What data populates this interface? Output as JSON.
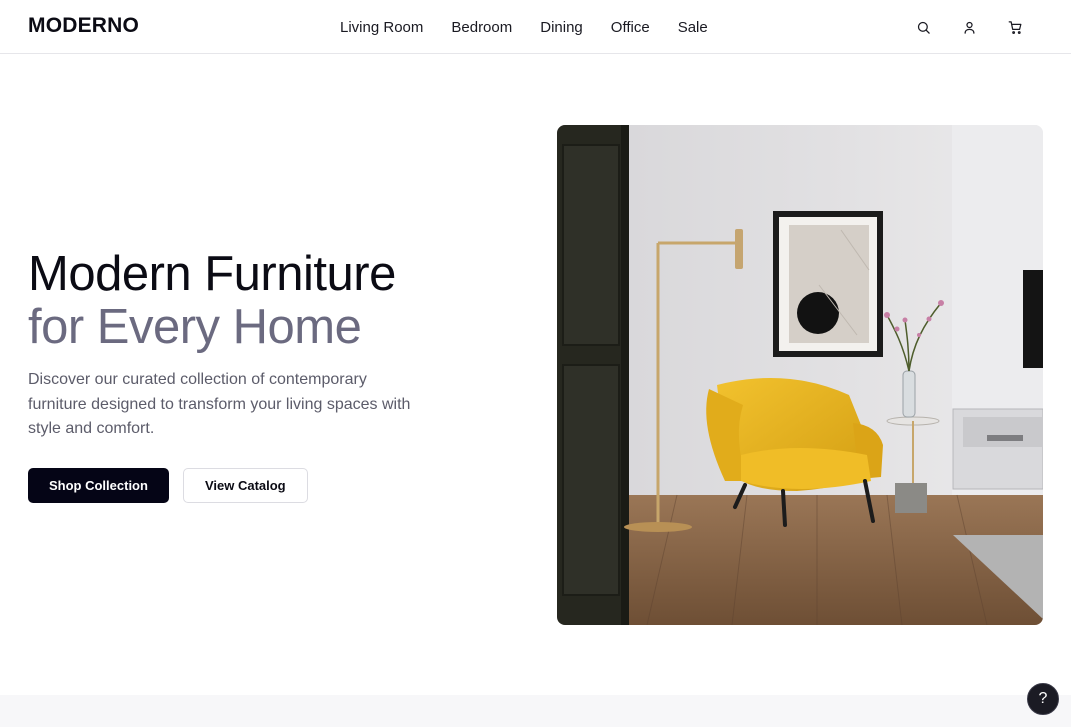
{
  "brand": {
    "name": "MODERNO"
  },
  "nav": {
    "items": [
      {
        "label": "Living Room"
      },
      {
        "label": "Bedroom"
      },
      {
        "label": "Dining"
      },
      {
        "label": "Office"
      },
      {
        "label": "Sale"
      }
    ]
  },
  "header_icons": [
    "search-icon",
    "user-icon",
    "cart-icon"
  ],
  "hero": {
    "title_line1": "Modern Furniture",
    "title_line2": "for Every Home",
    "description": "Discover our curated collection of contemporary furniture designed to transform your living spaces with style and comfort.",
    "primary_button": "Shop Collection",
    "secondary_button": "View Catalog"
  },
  "help": {
    "label": "?"
  },
  "colors": {
    "text_dark": "#0b0b14",
    "title_accent": "#6b6a80",
    "button_primary": "#050516",
    "chair_yellow": "#e6b21e"
  }
}
